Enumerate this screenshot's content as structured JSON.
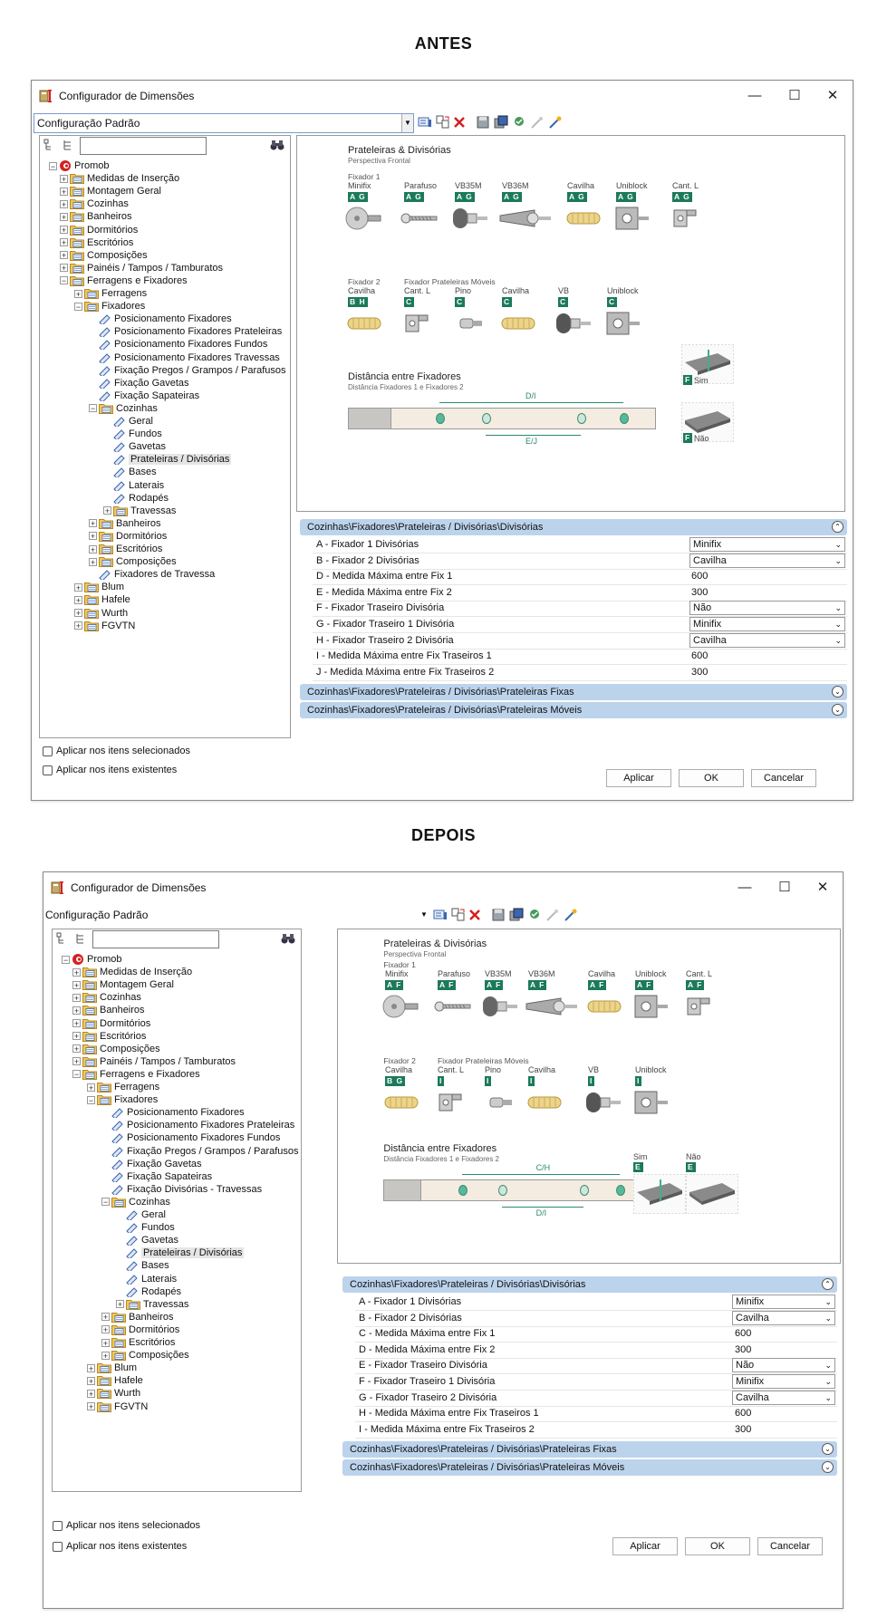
{
  "sections": {
    "before": "ANTES",
    "after": "DEPOIS"
  },
  "window": {
    "title": "Configurador de Dimensões",
    "minimize": "—",
    "maximize": "☐",
    "close": "✕"
  },
  "preset": {
    "before": "Configuração Padrão",
    "after": "Configuração Padrão"
  },
  "tree": {
    "root": "Promob",
    "l1": [
      "Medidas de Inserção",
      "Montagem Geral",
      "Cozinhas",
      "Banheiros",
      "Dormitórios",
      "Escritórios",
      "Composições",
      "Painéis / Tampos / Tamburatos",
      "Ferragens e Fixadores"
    ],
    "ferragens": "Ferragens",
    "fixadores": "Fixadores",
    "fix_leaves_before": [
      "Posicionamento Fixadores",
      "Posicionamento Fixadores Prateleiras",
      "Posicionamento Fixadores Fundos",
      "Posicionamento Fixadores Travessas",
      "Fixação Pregos / Grampos / Parafusos",
      "Fixação Gavetas",
      "Fixação Sapateiras"
    ],
    "fix_leaves_after": [
      "Posicionamento Fixadores",
      "Posicionamento Fixadores Prateleiras",
      "Posicionamento Fixadores Fundos",
      "Fixação Pregos / Grampos / Parafusos",
      "Fixação Gavetas",
      "Fixação Sapateiras",
      "Fixação Divisórias - Travessas"
    ],
    "cozinhas": "Cozinhas",
    "coz_leaves": [
      "Geral",
      "Fundos",
      "Gavetas",
      "Prateleiras / Divisórias",
      "Bases",
      "Laterais",
      "Rodapés"
    ],
    "travessas": "Travessas",
    "after_coz": [
      "Banheiros",
      "Dormitórios",
      "Escritórios",
      "Composições"
    ],
    "fixadores_travessa": "Fixadores de Travessa",
    "brands": [
      "Blum",
      "Hafele",
      "Wurth",
      "FGVTN"
    ]
  },
  "preview": {
    "title": "Prateleiras & Divisórias",
    "subtitle": "Perspectiva Frontal",
    "fix1_group": "Fixador 1",
    "fix1_items": [
      "Minifix",
      "Parafuso",
      "VB35M",
      "VB36M",
      "Cavilha",
      "Uniblock",
      "Cant. L"
    ],
    "fix1_badge_before": "A G",
    "fix1_badge_after": "A F",
    "fix2_group": "Fixador 2",
    "fixmov_group": "Fixador Prateleiras Móveis",
    "fix2_items": [
      "Cavilha",
      "Cant. L",
      "Pino",
      "Cavilha",
      "VB",
      "Uniblock"
    ],
    "fix2_badge_before": "B H",
    "fix2_badge_after": "B G",
    "fixmov_badge_before": "C",
    "fixmov_badge_after": "I",
    "dist_title": "Distância entre Fixadores",
    "dist_sub": "Distância Fixadores 1 e Fixadores 2",
    "dist_top_before": "D/I",
    "dist_bottom_before": "E/J",
    "dist_top_after": "C/H",
    "dist_bottom_after": "D/I",
    "sim": "Sim",
    "nao": "Não",
    "f_badge": "F",
    "e_badge": "E"
  },
  "props_before": {
    "header": "Cozinhas\\Fixadores\\Prateleiras / Divisórias\\Divisórias",
    "rows": [
      {
        "label": "A - Fixador 1 Divisórias",
        "value": "Minifix",
        "combo": true
      },
      {
        "label": "B - Fixador 2 Divisórias",
        "value": "Cavilha",
        "combo": true
      },
      {
        "label": "D - Medida Máxima entre Fix 1",
        "value": "600",
        "combo": false
      },
      {
        "label": "E - Medida Máxima entre Fix 2",
        "value": "300",
        "combo": false
      },
      {
        "label": "F - Fixador Traseiro Divisória",
        "value": "Não",
        "combo": true
      },
      {
        "label": "G - Fixador Traseiro 1 Divisória",
        "value": "Minifix",
        "combo": true
      },
      {
        "label": "H - Fixador Traseiro 2 Divisória",
        "value": "Cavilha",
        "combo": true
      },
      {
        "label": "I - Medida Máxima entre Fix Traseiros 1",
        "value": "600",
        "combo": false
      },
      {
        "label": "J - Medida Máxima entre Fix Traseiros 2",
        "value": "300",
        "combo": false
      }
    ],
    "header2": "Cozinhas\\Fixadores\\Prateleiras / Divisórias\\Prateleiras Fixas",
    "header3": "Cozinhas\\Fixadores\\Prateleiras / Divisórias\\Prateleiras Móveis"
  },
  "props_after": {
    "header": "Cozinhas\\Fixadores\\Prateleiras / Divisórias\\Divisórias",
    "rows": [
      {
        "label": "A - Fixador 1 Divisórias",
        "value": "Minifix",
        "combo": true
      },
      {
        "label": "B - Fixador 2 Divisórias",
        "value": "Cavilha",
        "combo": true
      },
      {
        "label": "C - Medida Máxima entre Fix 1",
        "value": "600",
        "combo": false
      },
      {
        "label": "D - Medida Máxima entre Fix 2",
        "value": "300",
        "combo": false
      },
      {
        "label": "E - Fixador Traseiro Divisória",
        "value": "Não",
        "combo": true
      },
      {
        "label": "F - Fixador Traseiro 1 Divisória",
        "value": "Minifix",
        "combo": true
      },
      {
        "label": "G - Fixador Traseiro 2 Divisória",
        "value": "Cavilha",
        "combo": true
      },
      {
        "label": "H - Medida Máxima entre Fix Traseiros 1",
        "value": "600",
        "combo": false
      },
      {
        "label": "I - Medida Máxima entre Fix Traseiros 2",
        "value": "300",
        "combo": false
      }
    ],
    "header2": "Cozinhas\\Fixadores\\Prateleiras / Divisórias\\Prateleiras Fixas",
    "header3": "Cozinhas\\Fixadores\\Prateleiras / Divisórias\\Prateleiras Móveis"
  },
  "footer": {
    "check1": "Aplicar nos itens selecionados",
    "check2": "Aplicar nos itens existentes",
    "apply": "Aplicar",
    "ok": "OK",
    "cancel": "Cancelar"
  },
  "icons": [
    "app-icon",
    "save-icon",
    "properties-icon",
    "delete-icon",
    "binoculars-icon",
    "folder-icon",
    "tool-icon"
  ],
  "colors": {
    "accent_green": "#1b7a5a",
    "header_blue": "#bcd3ec",
    "combo_border": "#7a9ccc",
    "delete_red": "#d42020"
  }
}
